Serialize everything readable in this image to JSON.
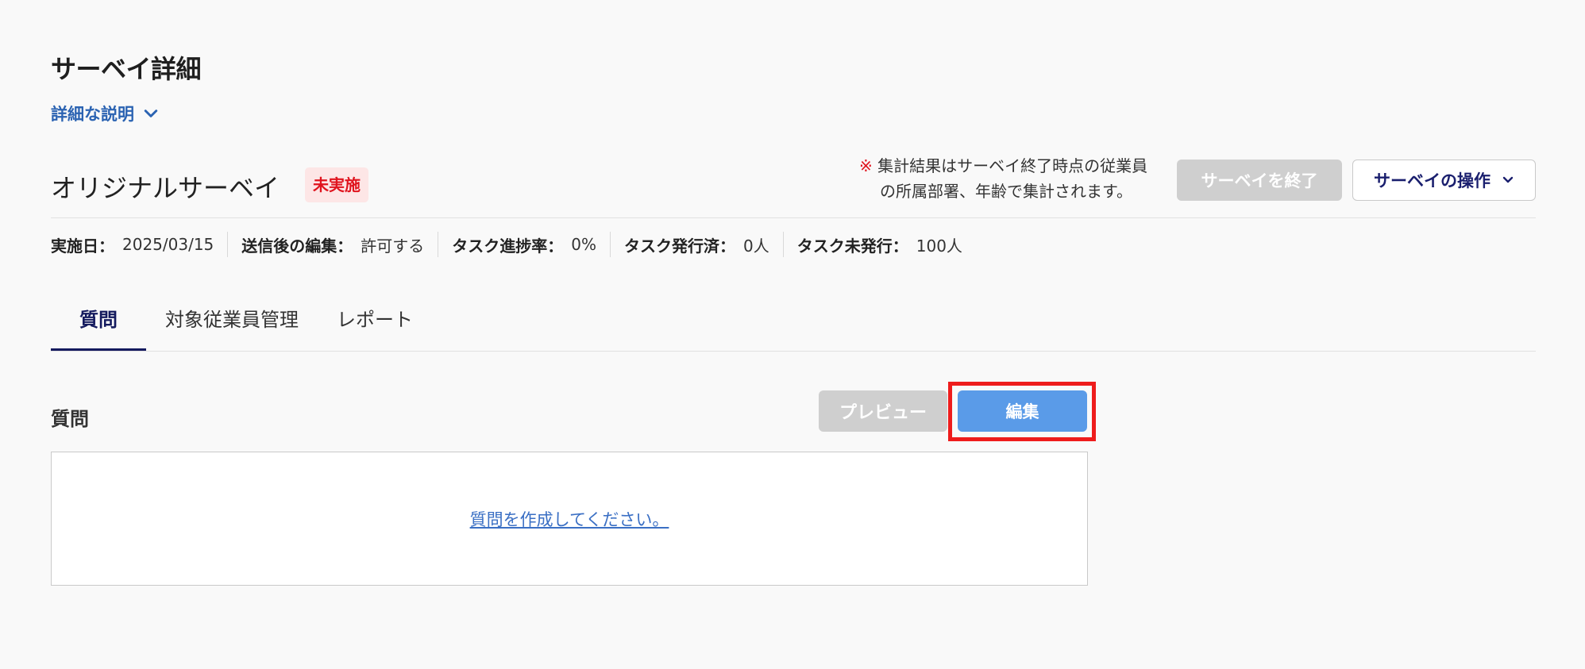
{
  "header": {
    "title": "サーベイ詳細",
    "description_toggle": "詳細な説明"
  },
  "survey": {
    "name": "オリジナルサーベイ",
    "status": "未実施",
    "note_mark": "※",
    "note_line1": "集計結果はサーベイ終了時点の従業員",
    "note_line2": "の所属部署、年齢で集計されます。",
    "end_button": "サーベイを終了",
    "ops_button": "サーベイの操作"
  },
  "meta": [
    {
      "label": "実施日：",
      "value": "2025/03/15"
    },
    {
      "label": "送信後の編集：",
      "value": "許可する"
    },
    {
      "label": "タスク進捗率：",
      "value": "0%"
    },
    {
      "label": "タスク発行済：",
      "value": "0人"
    },
    {
      "label": "タスク未発行：",
      "value": "100人"
    }
  ],
  "tabs": [
    {
      "label": "質問",
      "active": true
    },
    {
      "label": "対象従業員管理",
      "active": false
    },
    {
      "label": "レポート",
      "active": false
    }
  ],
  "questions": {
    "section_title": "質問",
    "preview_button": "プレビュー",
    "edit_button": "編集",
    "empty_message": "質問を作成してください。"
  },
  "colors": {
    "accent_navy": "#141a5e",
    "link_blue": "#2b63b2",
    "status_red": "#e0141e",
    "edit_blue": "#5a9be8",
    "highlight_red": "#ee1c1c"
  }
}
